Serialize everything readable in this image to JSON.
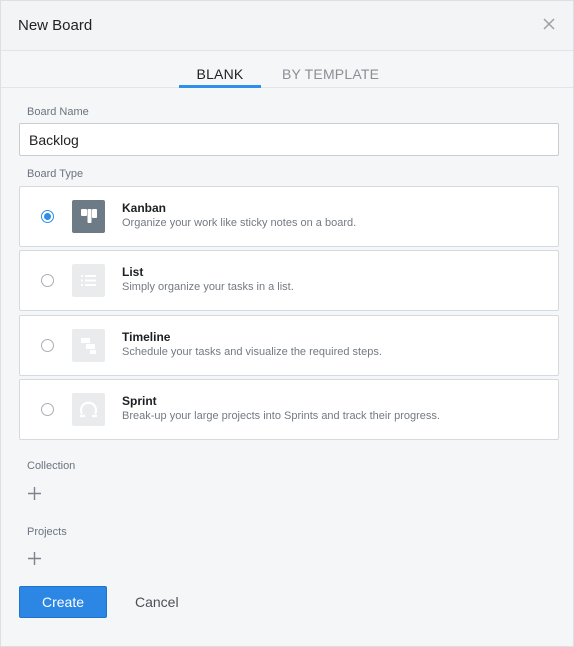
{
  "dialog": {
    "title": "New Board"
  },
  "tabs": [
    {
      "label": "BLANK",
      "active": true
    },
    {
      "label": "BY TEMPLATE",
      "active": false
    }
  ],
  "form": {
    "board_name_label": "Board Name",
    "board_name_value": "Backlog",
    "board_type_label": "Board Type",
    "collection_label": "Collection",
    "projects_label": "Projects"
  },
  "board_types": [
    {
      "title": "Kanban",
      "description": "Organize your work like sticky notes on a board.",
      "selected": true,
      "icon": "kanban-icon"
    },
    {
      "title": "List",
      "description": "Simply organize your tasks in a list.",
      "selected": false,
      "icon": "list-icon"
    },
    {
      "title": "Timeline",
      "description": "Schedule your tasks and visualize the required steps.",
      "selected": false,
      "icon": "timeline-icon"
    },
    {
      "title": "Sprint",
      "description": "Break-up your large projects into Sprints and track their progress.",
      "selected": false,
      "icon": "sprint-icon"
    }
  ],
  "actions": {
    "create_label": "Create",
    "cancel_label": "Cancel"
  },
  "colors": {
    "accent": "#2d8fe8",
    "primary_button": "#2b87e3",
    "active_icon_bg": "#6d7b87",
    "inactive_icon_bg": "#e9ebed"
  }
}
